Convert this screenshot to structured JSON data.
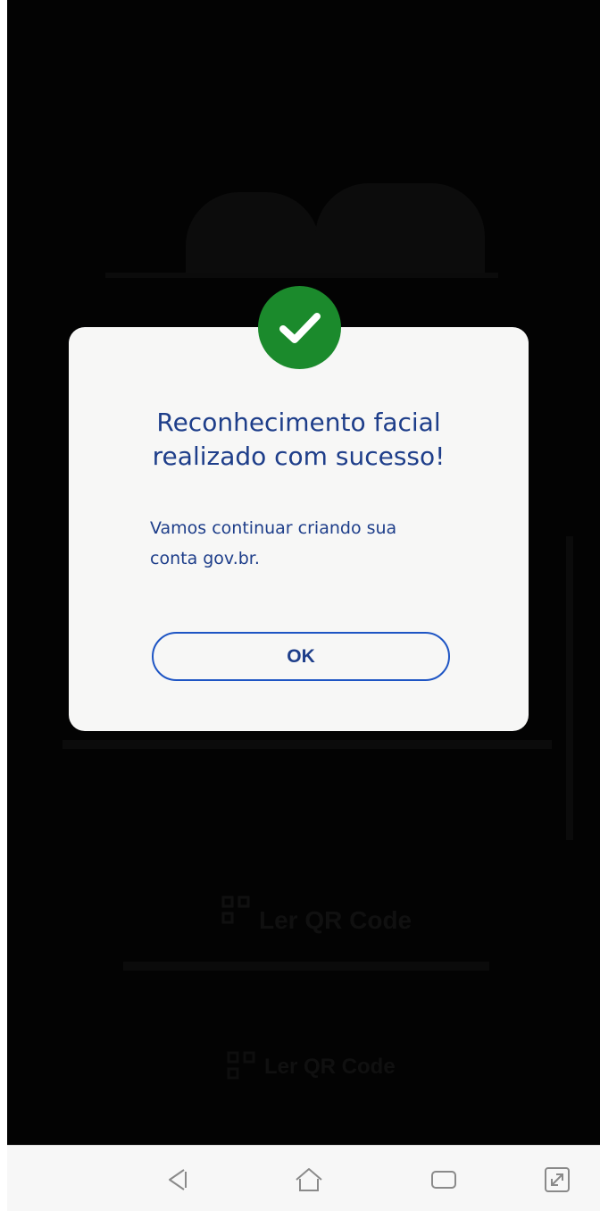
{
  "background": {
    "qr_label_1": "Ler QR Code",
    "qr_label_2": "Ler QR Code"
  },
  "dialog": {
    "title_line1": "Reconhecimento facial",
    "title_line2": "realizado com sucesso!",
    "message_line1": "Vamos continuar criando sua",
    "message_line2": "conta gov.br.",
    "ok_label": "OK",
    "status_icon": "check-icon",
    "status_color": "#1b8a2c",
    "accent_color": "#1e3e8a"
  },
  "navbar": {
    "icons": [
      "back-icon",
      "home-icon",
      "recents-icon",
      "screen-expand-icon"
    ]
  }
}
